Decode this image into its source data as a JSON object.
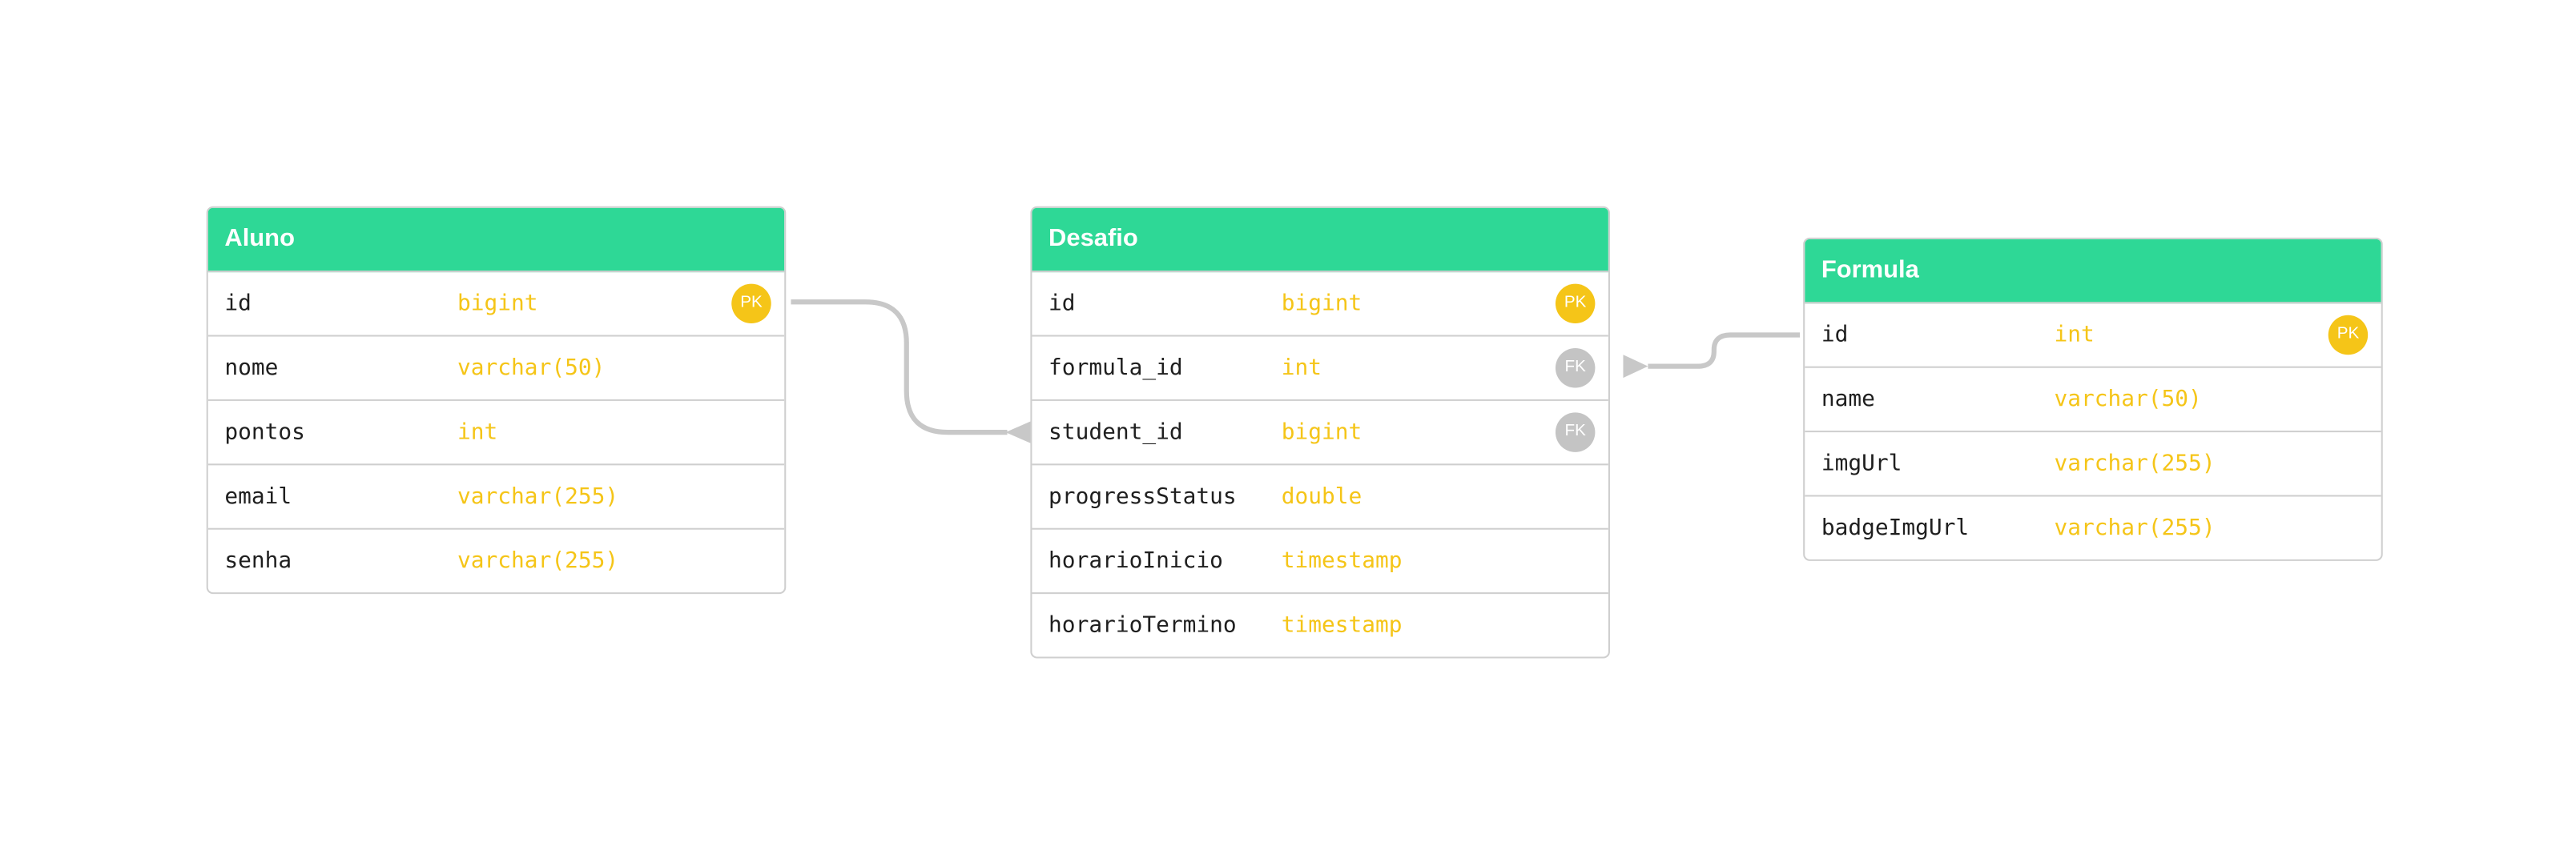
{
  "tables": [
    {
      "name": "Aluno",
      "columns": [
        {
          "name": "id",
          "type": "bigint",
          "key": "PK"
        },
        {
          "name": "nome",
          "type": "varchar(50)",
          "key": ""
        },
        {
          "name": "pontos",
          "type": "int",
          "key": ""
        },
        {
          "name": "email",
          "type": "varchar(255)",
          "key": ""
        },
        {
          "name": "senha",
          "type": "varchar(255)",
          "key": ""
        }
      ]
    },
    {
      "name": "Desafio",
      "columns": [
        {
          "name": "id",
          "type": "bigint",
          "key": "PK"
        },
        {
          "name": "formula_id",
          "type": "int",
          "key": "FK"
        },
        {
          "name": "student_id",
          "type": "bigint",
          "key": "FK"
        },
        {
          "name": "progressStatus",
          "type": "double",
          "key": ""
        },
        {
          "name": "horarioInicio",
          "type": "timestamp",
          "key": ""
        },
        {
          "name": "horarioTermino",
          "type": "timestamp",
          "key": ""
        }
      ]
    },
    {
      "name": "Formula",
      "columns": [
        {
          "name": "id",
          "type": "int",
          "key": "PK"
        },
        {
          "name": "name",
          "type": "varchar(50)",
          "key": ""
        },
        {
          "name": "imgUrl",
          "type": "varchar(255)",
          "key": ""
        },
        {
          "name": "badgeImgUrl",
          "type": "varchar(255)",
          "key": ""
        }
      ]
    }
  ],
  "relations": [
    {
      "from": "Aluno.id",
      "to": "Desafio.student_id"
    },
    {
      "from": "Formula.id",
      "to": "Desafio.formula_id"
    }
  ],
  "colors": {
    "header": "#2ed896",
    "type_text": "#f5c518",
    "pk_badge": "#f5c518",
    "fk_badge": "#c4c4c4",
    "connector": "#c8c8c8",
    "border": "#cfcfcf"
  }
}
